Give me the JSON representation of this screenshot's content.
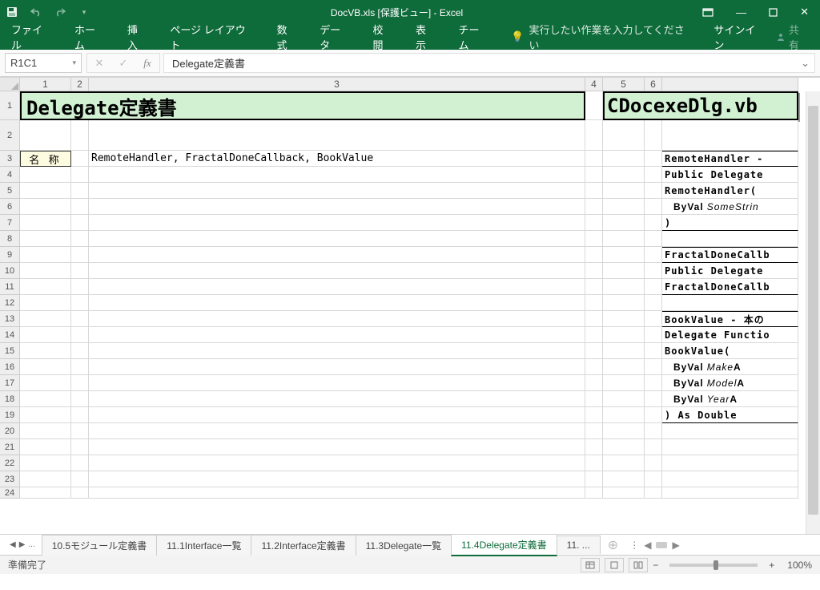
{
  "titlebar": {
    "title": "DocVB.xls  [保護ビュー] - Excel"
  },
  "ribbon": {
    "tabs": [
      "ファイル",
      "ホーム",
      "挿入",
      "ページ レイアウト",
      "数式",
      "データ",
      "校閲",
      "表示",
      "チーム"
    ],
    "tellme": "実行したい作業を入力してください",
    "signin": "サインイン",
    "share": "共有"
  },
  "formula": {
    "namebox": "R1C1",
    "fx": "fx",
    "value": "Delegate定義書"
  },
  "cols": [
    "1",
    "2",
    "3",
    "4",
    "5",
    "6"
  ],
  "content": {
    "title_main": "Delegate定義書",
    "title_vb": "CDocexeDlg.vb",
    "label_name": "名 称",
    "names_list": "RemoteHandler, FractalDoneCallback, BookValue",
    "code": {
      "l3": "RemoteHandler - ",
      "l4": "Public Delegate ",
      "l5": "RemoteHandler(",
      "l6_pre": "ByVal",
      "l6_it": "SomeStrin",
      "l7": ")",
      "l9": "FractalDoneCallb",
      "l10": "Public Delegate ",
      "l11": "FractalDoneCallb",
      "l13": "BookValue - 本の",
      "l14": "Delegate Functio",
      "l15": "BookValue(",
      "l16_pre": "ByVal",
      "l16_it": "Make",
      "l16_suf": "   A",
      "l17_pre": "ByVal",
      "l17_it": "Model",
      "l17_suf": "  A",
      "l18_pre": "ByVal",
      "l18_it": "Year",
      "l18_suf": "   A",
      "l19": ") As Double"
    }
  },
  "tabs": {
    "nav_more": "...",
    "sheets": [
      "10.5モジュール定義書",
      "11.1Interface一覧",
      "11.2Interface定義書",
      "11.3Delegate一覧",
      "11.4Delegate定義書",
      "11. ..."
    ],
    "active_index": 4,
    "plus": "⊕"
  },
  "status": {
    "left": "準備完了",
    "zoom_minus": "−",
    "zoom_plus": "+",
    "zoom": "100%"
  },
  "rows": [
    "1",
    "2",
    "3",
    "4",
    "5",
    "6",
    "7",
    "8",
    "9",
    "10",
    "11",
    "12",
    "13",
    "14",
    "15",
    "16",
    "17",
    "18",
    "19",
    "20",
    "21",
    "22",
    "23",
    "24"
  ]
}
